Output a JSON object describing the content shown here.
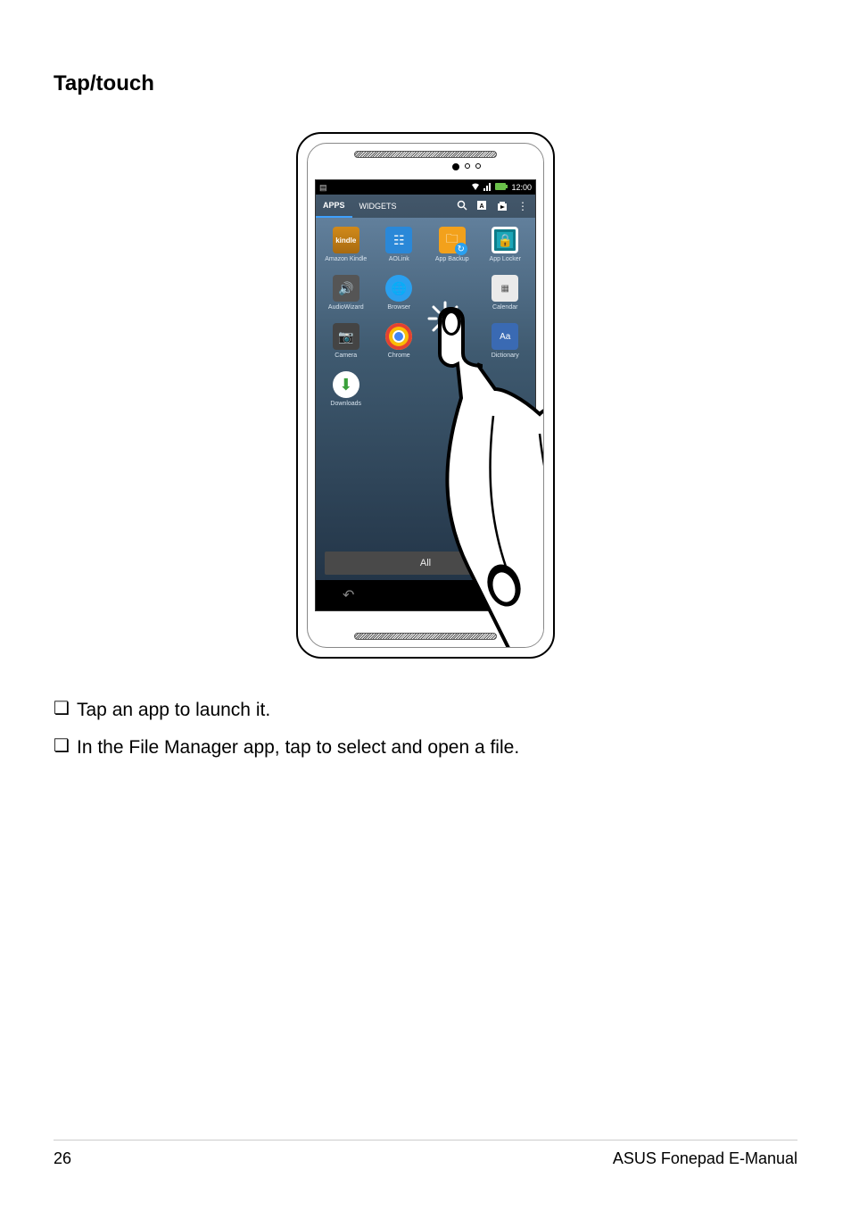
{
  "heading": "Tap/touch",
  "phone": {
    "status_time": "12:00",
    "tabs": {
      "apps": "APPS",
      "widgets": "WIDGETS"
    },
    "apps": {
      "r1c1": "Amazon Kindle",
      "r1c2": "AOLink",
      "r1c3": "App Backup",
      "r1c4": "App Locker",
      "r2c1": "AudioWizard",
      "r2c2": "Browser",
      "r2c4": "Calendar",
      "r3c1": "Camera",
      "r3c2": "Chrome",
      "r3c4": "Dictionary",
      "r4c1": "Downloads"
    },
    "all_button": "All",
    "dict_icon_text": "Aa"
  },
  "bullets": {
    "b1": "Tap an app to launch it.",
    "b2": "In the File Manager app, tap to select and open a file."
  },
  "footer": {
    "page": "26",
    "title": "ASUS Fonepad E-Manual"
  }
}
